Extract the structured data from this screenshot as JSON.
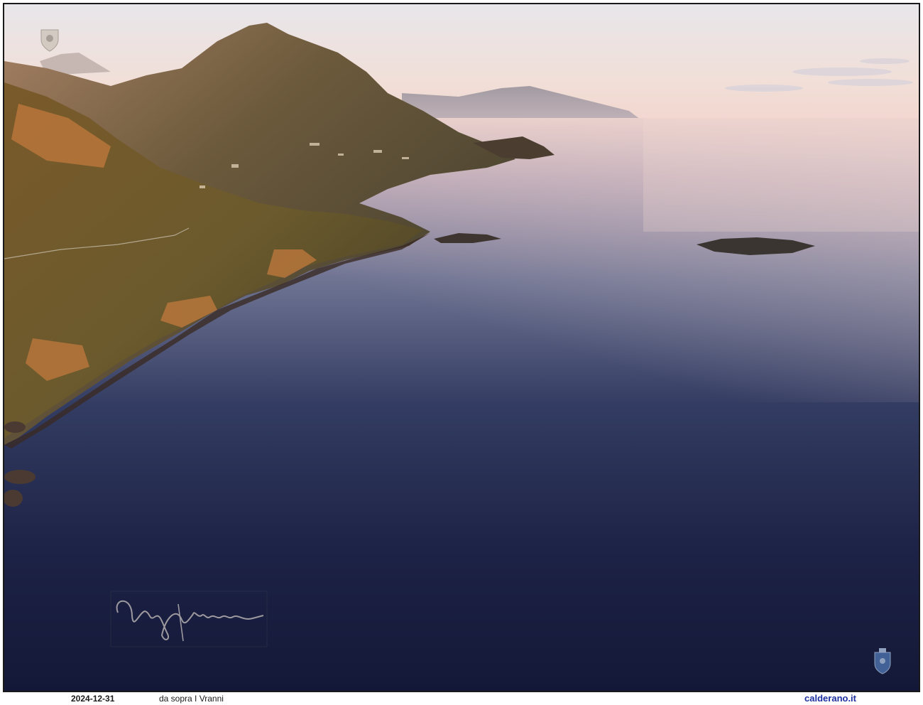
{
  "photo": {
    "subject": "aerial-coastline-sunrise",
    "colors": {
      "sky_top": "#e9e4e6",
      "sky_horizon": "#f3d9cf",
      "sea_far": "#c8b2bc",
      "sea_mid": "#4a5677",
      "sea_near": "#161b3a",
      "mountain_lit": "#9a6d4f",
      "mountain_shade": "#3b3a2c",
      "vegetation": "#6a5a2c",
      "cliff_orange": "#c7793a"
    }
  },
  "watermarks": {
    "top_left_icon": "crest-icon",
    "bottom_right_icon": "shield-crest-icon",
    "signature": "handwritten-signature"
  },
  "caption": {
    "date": "2024-12-31",
    "title": "da sopra I Vranni",
    "site": "calderano.it"
  }
}
